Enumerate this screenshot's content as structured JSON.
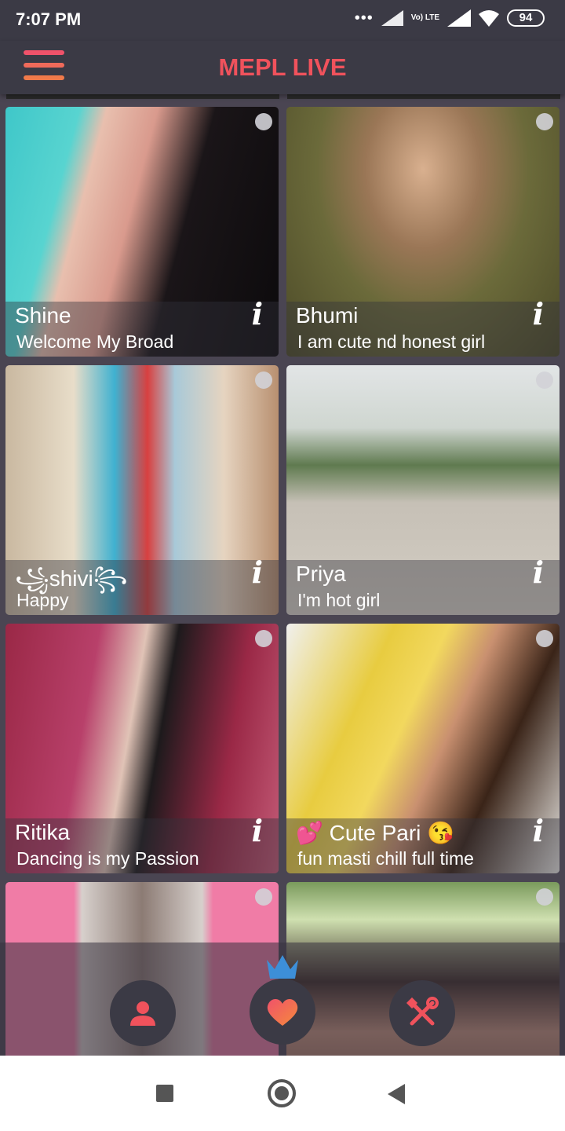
{
  "status_bar": {
    "time": "7:07 PM",
    "network": "Vo) LTE",
    "battery": "94"
  },
  "app": {
    "title": "MEPL LIVE",
    "accent": "#f0525c"
  },
  "profiles": [
    {
      "name": "Shine",
      "bio": "Welcome My Broad"
    },
    {
      "name": "Bhumi",
      "bio": "I am cute nd honest girl"
    },
    {
      "name": "꧁shivi꧂",
      "bio": "Happy"
    },
    {
      "name": "Priya",
      "bio": "I'm hot girl"
    },
    {
      "name": "Ritika",
      "bio": "Dancing is my Passion"
    },
    {
      "name": "💕 Cute Pari 😘",
      "bio": "fun masti chill full time"
    },
    {
      "name": "",
      "bio": ""
    },
    {
      "name": "",
      "bio": ""
    }
  ],
  "info_glyph": "i",
  "bottom_nav": [
    "profile-icon",
    "crowned-heart-icon",
    "tools-icon"
  ],
  "system_nav": [
    "recents-icon",
    "home-icon",
    "back-icon"
  ]
}
